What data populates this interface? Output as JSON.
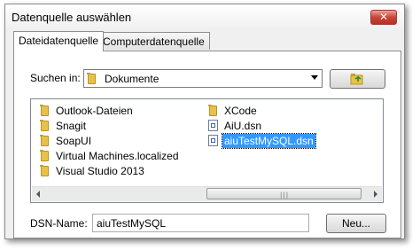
{
  "window": {
    "title": "Datenquelle auswählen",
    "close_glyph": "✕"
  },
  "tabs": [
    {
      "label": "Dateidatenquelle"
    },
    {
      "label": "Computerdatenquelle"
    }
  ],
  "lookin": {
    "label": "Suchen in:",
    "value": "Dokumente",
    "folder_icon": "folder-icon"
  },
  "up_button_icon": "folder-up-icon",
  "files": [
    {
      "name": "Outlook-Dateien",
      "icon": "folder-icon"
    },
    {
      "name": "Snagit",
      "icon": "folder-icon"
    },
    {
      "name": "SoapUI",
      "icon": "folder-icon"
    },
    {
      "name": "Virtual Machines.localized",
      "icon": "folder-icon"
    },
    {
      "name": "Visual Studio 2013",
      "icon": "folder-icon"
    },
    {
      "name": "XCode",
      "icon": "folder-icon"
    },
    {
      "name": "AiU.dsn",
      "icon": "dsn-file-icon"
    },
    {
      "name": "aiuTestMySQL.dsn",
      "icon": "dsn-file-icon",
      "selected": true
    }
  ],
  "dsn": {
    "label": "DSN-Name:",
    "value": "aiuTestMySQL"
  },
  "new_button": {
    "label": "Neu..."
  },
  "colors": {
    "selection": "#3399ff",
    "folder": "#e8c14a",
    "close_button": "#c9463a"
  }
}
